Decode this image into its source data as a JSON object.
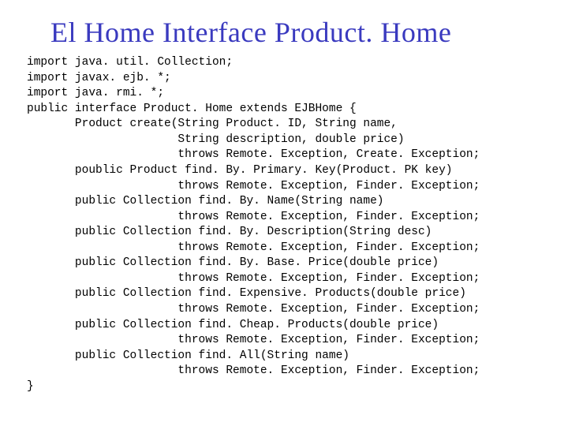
{
  "title": "El Home Interface Product. Home",
  "code_lines": [
    "import java. util. Collection;",
    "import javax. ejb. *;",
    "import java. rmi. *;",
    "public interface Product. Home extends EJBHome {",
    "       Product create(String Product. ID, String name,",
    "                      String description, double price)",
    "                      throws Remote. Exception, Create. Exception;",
    "       poublic Product find. By. Primary. Key(Product. PK key)",
    "                      throws Remote. Exception, Finder. Exception;",
    "       public Collection find. By. Name(String name)",
    "                      throws Remote. Exception, Finder. Exception;",
    "       public Collection find. By. Description(String desc)",
    "                      throws Remote. Exception, Finder. Exception;",
    "       public Collection find. By. Base. Price(double price)",
    "                      throws Remote. Exception, Finder. Exception;",
    "       public Collection find. Expensive. Products(double price)",
    "                      throws Remote. Exception, Finder. Exception;",
    "       public Collection find. Cheap. Products(double price)",
    "                      throws Remote. Exception, Finder. Exception;",
    "       public Collection find. All(String name)",
    "                      throws Remote. Exception, Finder. Exception;",
    "}"
  ]
}
